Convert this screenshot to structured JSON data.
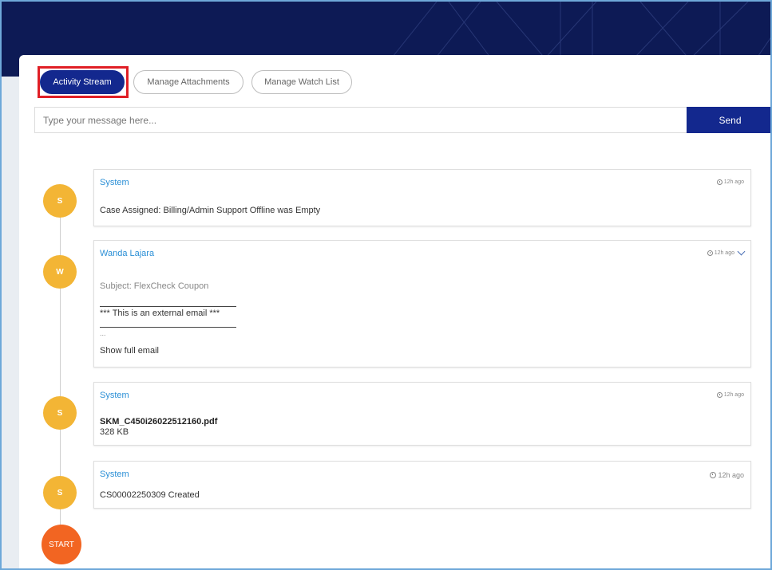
{
  "tabs": {
    "activity_stream": "Activity Stream",
    "manage_attachments": "Manage Attachments",
    "manage_watch_list": "Manage Watch List"
  },
  "composer": {
    "placeholder": "Type your message here...",
    "send_label": "Send"
  },
  "timeline": {
    "entries": [
      {
        "avatar": "S",
        "author": "System",
        "time": "12h ago",
        "body": "Case Assigned: Billing/Admin Support Offline was Empty"
      },
      {
        "avatar": "W",
        "author": "Wanda Lajara",
        "time": "12h ago",
        "subject": "Subject: FlexCheck Coupon",
        "external_notice": "*** This is an external email ***",
        "ellipsis": "...",
        "show_full": "Show full email"
      },
      {
        "avatar": "S",
        "author": "System",
        "time": "12h ago",
        "file_name": "SKM_C450i26022512160.pdf",
        "file_size": "328 KB"
      },
      {
        "avatar": "S",
        "author": "System",
        "time": "12h ago",
        "body": "CS00002250309 Created"
      }
    ],
    "start_label": "START"
  },
  "colors": {
    "banner": "#0d1a55",
    "primary": "#13288e",
    "highlight": "#e01f26",
    "author_link": "#2a8fd6",
    "avatar_system": "#f3b535",
    "start_node": "#f26522"
  }
}
